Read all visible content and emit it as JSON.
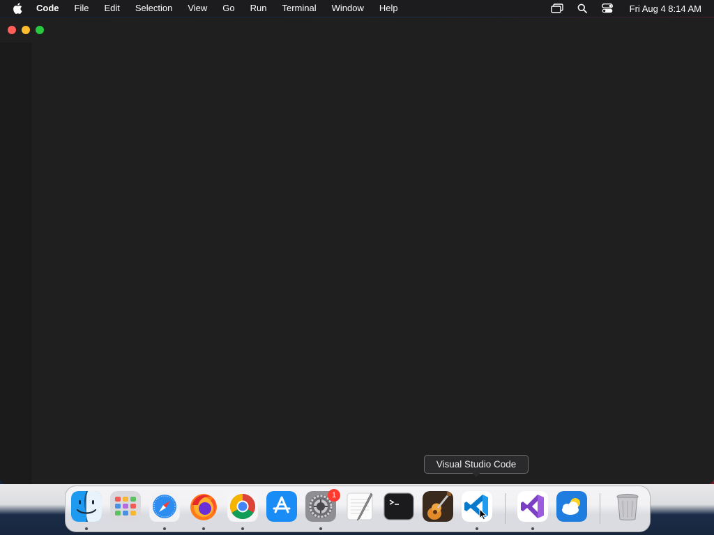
{
  "menubar": {
    "app_name": "Code",
    "items": [
      "File",
      "Edit",
      "Selection",
      "View",
      "Go",
      "Run",
      "Terminal",
      "Window",
      "Help"
    ],
    "status_icons": [
      "screen-mirroring-icon",
      "spotlight-search-icon",
      "control-center-icon"
    ],
    "clock": "Fri Aug 4  8:14 AM"
  },
  "window": {
    "app": "Visual Studio Code",
    "traffic_lights": {
      "close": "#ff5f57",
      "minimize": "#febc2e",
      "maximize": "#28c840"
    },
    "background": "#1f1f1f"
  },
  "tooltip": {
    "text": "Visual Studio Code"
  },
  "dock": {
    "apps": [
      {
        "name": "Finder",
        "icon": "finder-icon",
        "running": true
      },
      {
        "name": "Launchpad",
        "icon": "launchpad-icon",
        "running": false
      },
      {
        "name": "Safari",
        "icon": "safari-icon",
        "running": true
      },
      {
        "name": "Firefox",
        "icon": "firefox-icon",
        "running": true
      },
      {
        "name": "Google Chrome",
        "icon": "chrome-icon",
        "running": true
      },
      {
        "name": "App Store",
        "icon": "app-store-icon",
        "running": false
      },
      {
        "name": "System Settings",
        "icon": "system-settings-icon",
        "running": true,
        "badge": "1"
      },
      {
        "name": "TextEdit",
        "icon": "textedit-icon",
        "running": false
      },
      {
        "name": "Terminal",
        "icon": "terminal-icon",
        "running": false
      },
      {
        "name": "GarageBand",
        "icon": "garageband-icon",
        "running": false
      },
      {
        "name": "Visual Studio Code",
        "icon": "vscode-icon",
        "running": true
      },
      {
        "name": "Visual Studio",
        "icon": "visual-studio-icon",
        "running": true
      },
      {
        "name": "Weather",
        "icon": "weather-icon",
        "running": false
      },
      {
        "name": "Trash",
        "icon": "trash-icon",
        "running": false
      }
    ]
  }
}
